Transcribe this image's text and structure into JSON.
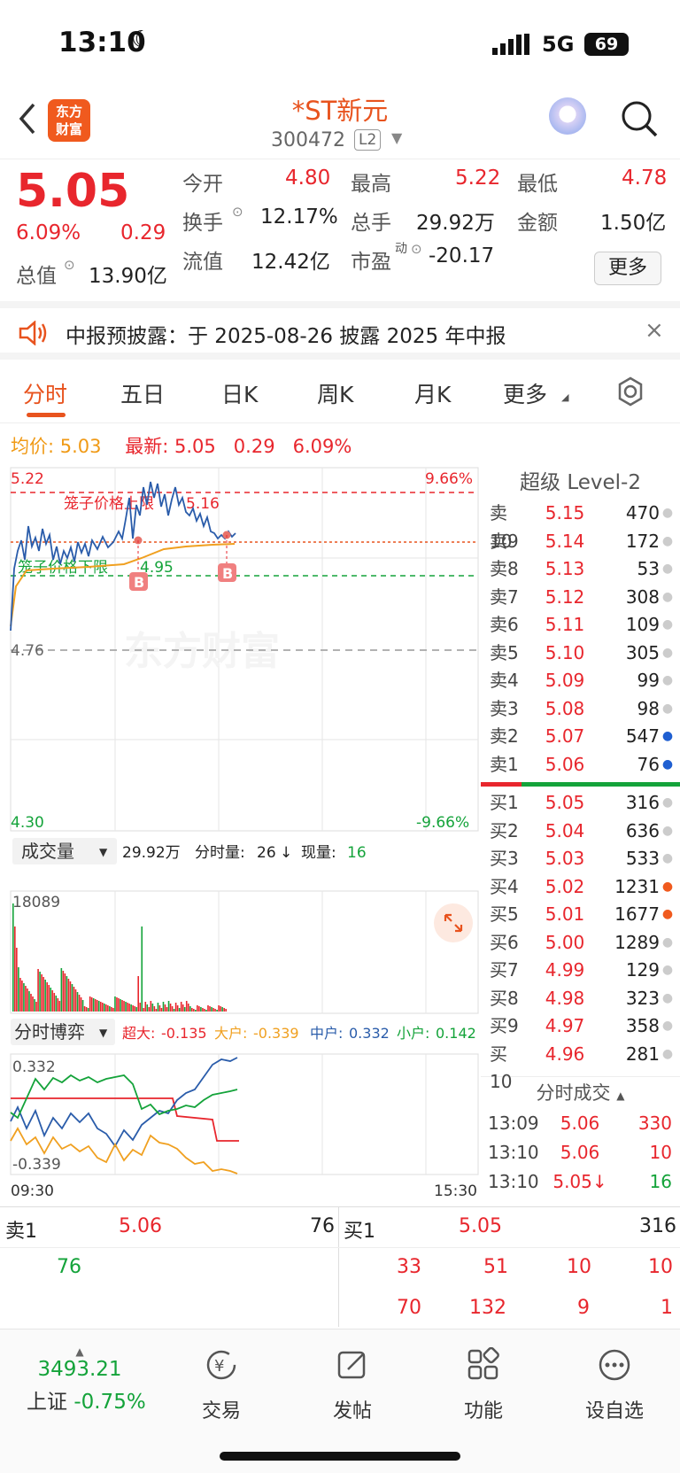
{
  "status": {
    "time": "13:10",
    "network": "5G",
    "battery": "69"
  },
  "header": {
    "logo_line1": "东方",
    "logo_line2": "财富",
    "title": "*ST新元",
    "code": "300472",
    "level": "L2"
  },
  "quote": {
    "price": "5.05",
    "pct": "6.09%",
    "change": "0.29",
    "open_label": "今开",
    "open": "4.80",
    "high_label": "最高",
    "high": "5.22",
    "low_label": "最低",
    "low": "4.78",
    "turnover_label": "换手",
    "turnover": "12.17%",
    "volume_label": "总手",
    "volume": "29.92万",
    "amount_label": "金额",
    "amount": "1.50亿",
    "mktcap_label": "总值",
    "mktcap": "13.90亿",
    "float_label": "流值",
    "float": "12.42亿",
    "pe_label": "市盈",
    "pe_sup": "动",
    "pe": "-20.17",
    "more": "更多"
  },
  "notice": {
    "text": "中报预披露：于 2025-08-26 披露 2025 年中报",
    "close": "×"
  },
  "tabs": [
    "分时",
    "五日",
    "日K",
    "周K",
    "月K",
    "更多"
  ],
  "chart_info": {
    "avg_label": "均价:",
    "avg": "5.03",
    "last_label": "最新:",
    "last": "5.05",
    "change": "0.29",
    "pct": "6.09%"
  },
  "chart": {
    "y_top": "5.22",
    "y_top_pct": "9.66%",
    "y_mid": "4.76",
    "y_bot": "4.30",
    "y_bot_pct": "-9.66%",
    "cage_upper_label": "笼子价格上限",
    "cage_upper": "5.16",
    "cage_lower_label": "笼子价格下限",
    "cage_lower": "4.95",
    "watermark": "东方财富",
    "buy_marker": "B"
  },
  "volume": {
    "selector": "成交量",
    "total": "29.92万",
    "tick_label": "分时量:",
    "tick": "26",
    "arrow": "↓",
    "now_label": "现量:",
    "now": "16",
    "max": "18089"
  },
  "game": {
    "selector": "分时博弈",
    "super_label": "超大:",
    "super": "-0.135",
    "big_label": "大户:",
    "big": "-0.339",
    "mid_label": "中户:",
    "mid": "0.332",
    "small_label": "小户:",
    "small": "0.142",
    "top": "0.332",
    "bot": "-0.339",
    "t_start": "09:30",
    "t_end": "15:30"
  },
  "book": {
    "title": "超级 Level-2",
    "asks": [
      {
        "label": "卖10",
        "price": "5.15",
        "vol": "470",
        "dot": "gray"
      },
      {
        "label": "卖9",
        "price": "5.14",
        "vol": "172",
        "dot": "gray"
      },
      {
        "label": "卖8",
        "price": "5.13",
        "vol": "53",
        "dot": "gray"
      },
      {
        "label": "卖7",
        "price": "5.12",
        "vol": "308",
        "dot": "gray"
      },
      {
        "label": "卖6",
        "price": "5.11",
        "vol": "109",
        "dot": "gray"
      },
      {
        "label": "卖5",
        "price": "5.10",
        "vol": "305",
        "dot": "gray"
      },
      {
        "label": "卖4",
        "price": "5.09",
        "vol": "99",
        "dot": "gray"
      },
      {
        "label": "卖3",
        "price": "5.08",
        "vol": "98",
        "dot": "gray"
      },
      {
        "label": "卖2",
        "price": "5.07",
        "vol": "547",
        "dot": "blue"
      },
      {
        "label": "卖1",
        "price": "5.06",
        "vol": "76",
        "dot": "blue"
      }
    ],
    "bids": [
      {
        "label": "买1",
        "price": "5.05",
        "vol": "316",
        "dot": "gray"
      },
      {
        "label": "买2",
        "price": "5.04",
        "vol": "636",
        "dot": "gray"
      },
      {
        "label": "买3",
        "price": "5.03",
        "vol": "533",
        "dot": "gray"
      },
      {
        "label": "买4",
        "price": "5.02",
        "vol": "1231",
        "dot": "org"
      },
      {
        "label": "买5",
        "price": "5.01",
        "vol": "1677",
        "dot": "org"
      },
      {
        "label": "买6",
        "price": "5.00",
        "vol": "1289",
        "dot": "gray"
      },
      {
        "label": "买7",
        "price": "4.99",
        "vol": "129",
        "dot": "gray"
      },
      {
        "label": "买8",
        "price": "4.98",
        "vol": "323",
        "dot": "gray"
      },
      {
        "label": "买9",
        "price": "4.97",
        "vol": "358",
        "dot": "gray"
      },
      {
        "label": "买10",
        "price": "4.96",
        "vol": "281",
        "dot": "gray"
      }
    ],
    "trades_title": "分时成交",
    "trades": [
      {
        "time": "13:09",
        "price": "5.06",
        "vol": "330"
      },
      {
        "time": "13:10",
        "price": "5.06",
        "vol": "10"
      },
      {
        "time": "13:10",
        "price": "5.05↓",
        "vol": "16"
      }
    ]
  },
  "queue": {
    "ask_label": "卖1",
    "ask_price": "5.06",
    "ask_vol": "76",
    "ask_items": [
      "76"
    ],
    "bid_label": "买1",
    "bid_price": "5.05",
    "bid_vol": "316",
    "bid_items_row1": [
      "33",
      "51",
      "10",
      "10"
    ],
    "bid_items_row2": [
      "70",
      "132",
      "9",
      "1"
    ]
  },
  "tabbar": {
    "index_value": "3493.21",
    "index_name": "上证",
    "index_pct": "-0.75%",
    "trade": "交易",
    "post": "发帖",
    "func": "功能",
    "watch": "设自选"
  },
  "colors": {
    "up": "#e8262d",
    "down": "#14a33a",
    "accent": "#e8531e",
    "avg": "#f0a020",
    "price_line": "#2a5caa"
  }
}
